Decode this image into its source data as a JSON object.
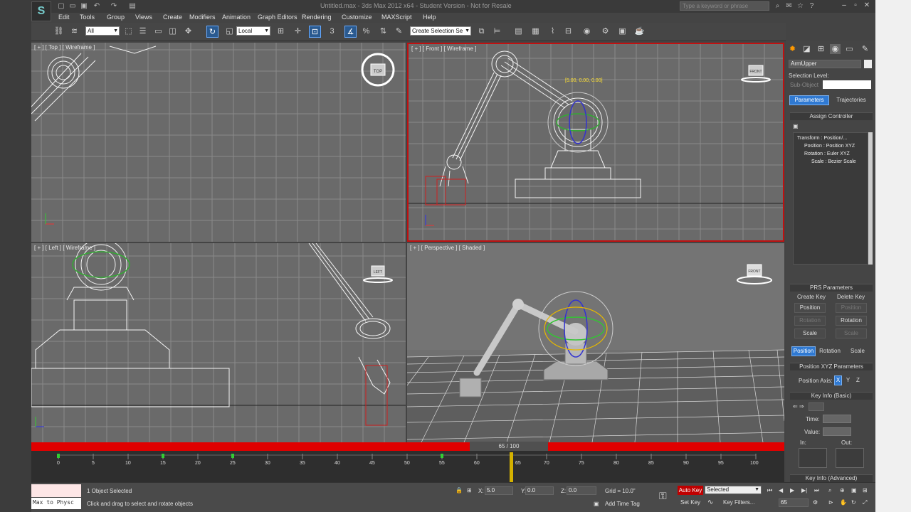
{
  "title_bar": {
    "app_title": "Untitled.max - 3ds Max 2012 x64 - Student Version - Not for Resale",
    "search_placeholder": "Type a keyword or phrase",
    "quick_access": [
      "new-icon",
      "open-icon",
      "save-icon",
      "undo-icon",
      "redo-icon",
      "project-folder-icon"
    ],
    "window_controls": [
      "minimize-icon",
      "restore-icon",
      "close-icon"
    ]
  },
  "menu": [
    "Edit",
    "Tools",
    "Group",
    "Views",
    "Create",
    "Modifiers",
    "Animation",
    "Graph Editors",
    "Rendering",
    "Customize",
    "MAXScript",
    "Help"
  ],
  "toolbar": {
    "selection_filter": "All",
    "reference_coord": "Local",
    "named_selection": "Create Selection Se",
    "snap_label": "3"
  },
  "viewports": {
    "top": "[ + ] [ Top ] [ Wireframe ]",
    "front": "[ + ] [ Front ] [ Wireframe ]",
    "left": "[ + ] [ Left ] [ Wireframe ]",
    "perspective": "[ + ] [ Perspective ] [ Shaded ]",
    "coord_readout": "[5.00, 0.00, 0.00]",
    "viewcube_top": "TOP",
    "viewcube_front": "FRONT",
    "viewcube_left": "LEFT",
    "viewcube_persp": "FRONT"
  },
  "command_panel": {
    "object_name": "ArmUpper",
    "selection_level": "Selection Level:",
    "sub_object": "Sub-Object",
    "tab_parameters": "Parameters",
    "tab_trajectories": "Trajectories",
    "assign_controller": "Assign Controller",
    "tree": [
      "Transform : Position/...",
      "Position : Position XYZ",
      "Rotation : Euler XYZ",
      "Scale : Bezier Scale"
    ],
    "prs_title": "PRS Parameters",
    "create_key": "Create Key",
    "delete_key": "Delete Key",
    "position": "Position",
    "rotation": "Rotation",
    "scale": "Scale",
    "position_xyz": "Position XYZ Parameters",
    "position_axis": "Position Axis:",
    "axis_x": "X",
    "axis_y": "Y",
    "axis_z": "Z",
    "key_info_basic": "Key Info (Basic)",
    "time_label": "Time:",
    "value_label": "Value:",
    "in_label": "In:",
    "out_label": "Out:",
    "key_info_adv": "Key Info (Advanced)"
  },
  "timeline": {
    "slider": "65 / 100",
    "ticks": [
      "0",
      "5",
      "10",
      "15",
      "20",
      "25",
      "30",
      "35",
      "40",
      "45",
      "50",
      "55",
      "60",
      "65",
      "70",
      "75",
      "80",
      "85",
      "90",
      "95",
      "100"
    ]
  },
  "status": {
    "maxscript": "Max to Physc",
    "selected": "1 Object Selected",
    "prompt": "Click and drag to select and rotate objects",
    "x_label": "X:",
    "x_value": "5.0",
    "y_label": "Y:",
    "y_value": "0.0",
    "z_label": "Z:",
    "z_value": "0.0",
    "grid": "Grid = 10.0\"",
    "add_time_tag": "Add Time Tag",
    "auto_key": "Auto Key",
    "set_key": "Set Key",
    "key_mode": "Selected",
    "key_filters": "Key Filters...",
    "frame": "65"
  },
  "colors": {
    "accent_blue": "#2f79d2",
    "active_red": "#e00000",
    "viewport_bg": "#6a6a6a"
  }
}
